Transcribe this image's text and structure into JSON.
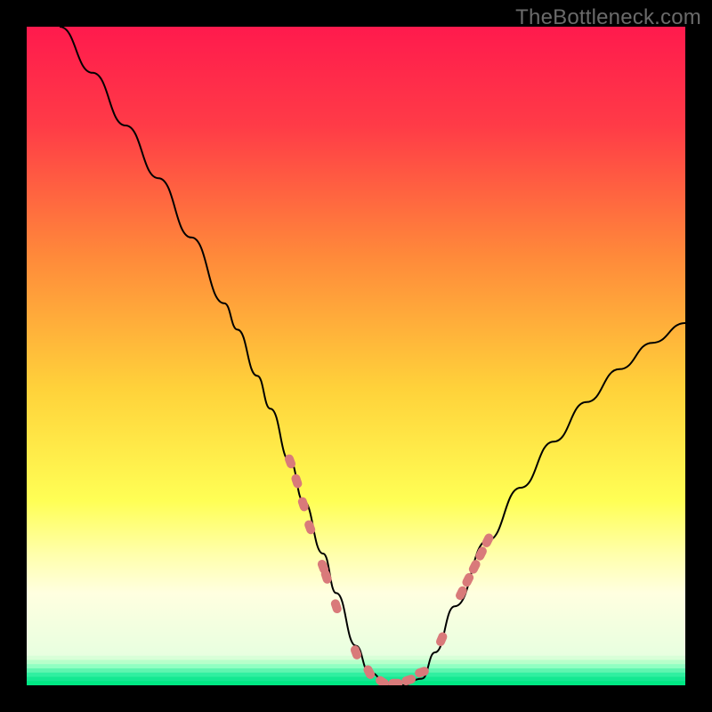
{
  "watermark": "TheBottleneck.com",
  "chart_data": {
    "type": "line",
    "title": "",
    "xlabel": "",
    "ylabel": "",
    "xlim": [
      0,
      100
    ],
    "ylim": [
      0,
      100
    ],
    "grid": false,
    "legend": false,
    "background_gradient": {
      "stops": [
        {
          "pos": 0.0,
          "color": "#ff1a4d"
        },
        {
          "pos": 0.15,
          "color": "#ff3b47"
        },
        {
          "pos": 0.35,
          "color": "#ff8a3a"
        },
        {
          "pos": 0.55,
          "color": "#ffd23a"
        },
        {
          "pos": 0.72,
          "color": "#ffff55"
        },
        {
          "pos": 0.8,
          "color": "#ffffaa"
        },
        {
          "pos": 0.86,
          "color": "#ffffe0"
        },
        {
          "pos": 0.955,
          "color": "#e8ffe0"
        },
        {
          "pos": 0.975,
          "color": "#8affc0"
        },
        {
          "pos": 1.0,
          "color": "#00e884"
        }
      ]
    },
    "series": [
      {
        "name": "bottleneck-curve",
        "color": "#000000",
        "x": [
          5,
          10,
          15,
          20,
          25,
          30,
          32,
          35,
          37,
          40,
          42,
          45,
          47,
          50,
          52,
          55,
          57,
          60,
          62,
          65,
          70,
          75,
          80,
          85,
          90,
          95,
          100
        ],
        "y": [
          100,
          93,
          85,
          77,
          68,
          58,
          54,
          47,
          42,
          34,
          28,
          20,
          14,
          6,
          2,
          0,
          0,
          1,
          5,
          12,
          22,
          30,
          37,
          43,
          48,
          52,
          55
        ]
      }
    ],
    "markers": {
      "name": "highlight-points",
      "color": "#d97a7a",
      "kind": "pill",
      "points": [
        {
          "x": 40,
          "y": 34
        },
        {
          "x": 41,
          "y": 31
        },
        {
          "x": 42,
          "y": 27.5
        },
        {
          "x": 43,
          "y": 24
        },
        {
          "x": 45,
          "y": 18
        },
        {
          "x": 45.5,
          "y": 16.5
        },
        {
          "x": 47,
          "y": 12
        },
        {
          "x": 50,
          "y": 5
        },
        {
          "x": 52,
          "y": 2
        },
        {
          "x": 54,
          "y": 0.5
        },
        {
          "x": 56,
          "y": 0.3
        },
        {
          "x": 58,
          "y": 0.8
        },
        {
          "x": 60,
          "y": 2
        },
        {
          "x": 63,
          "y": 7
        },
        {
          "x": 66,
          "y": 14
        },
        {
          "x": 67,
          "y": 16
        },
        {
          "x": 68,
          "y": 18
        },
        {
          "x": 69,
          "y": 20
        },
        {
          "x": 70,
          "y": 22
        }
      ]
    }
  }
}
